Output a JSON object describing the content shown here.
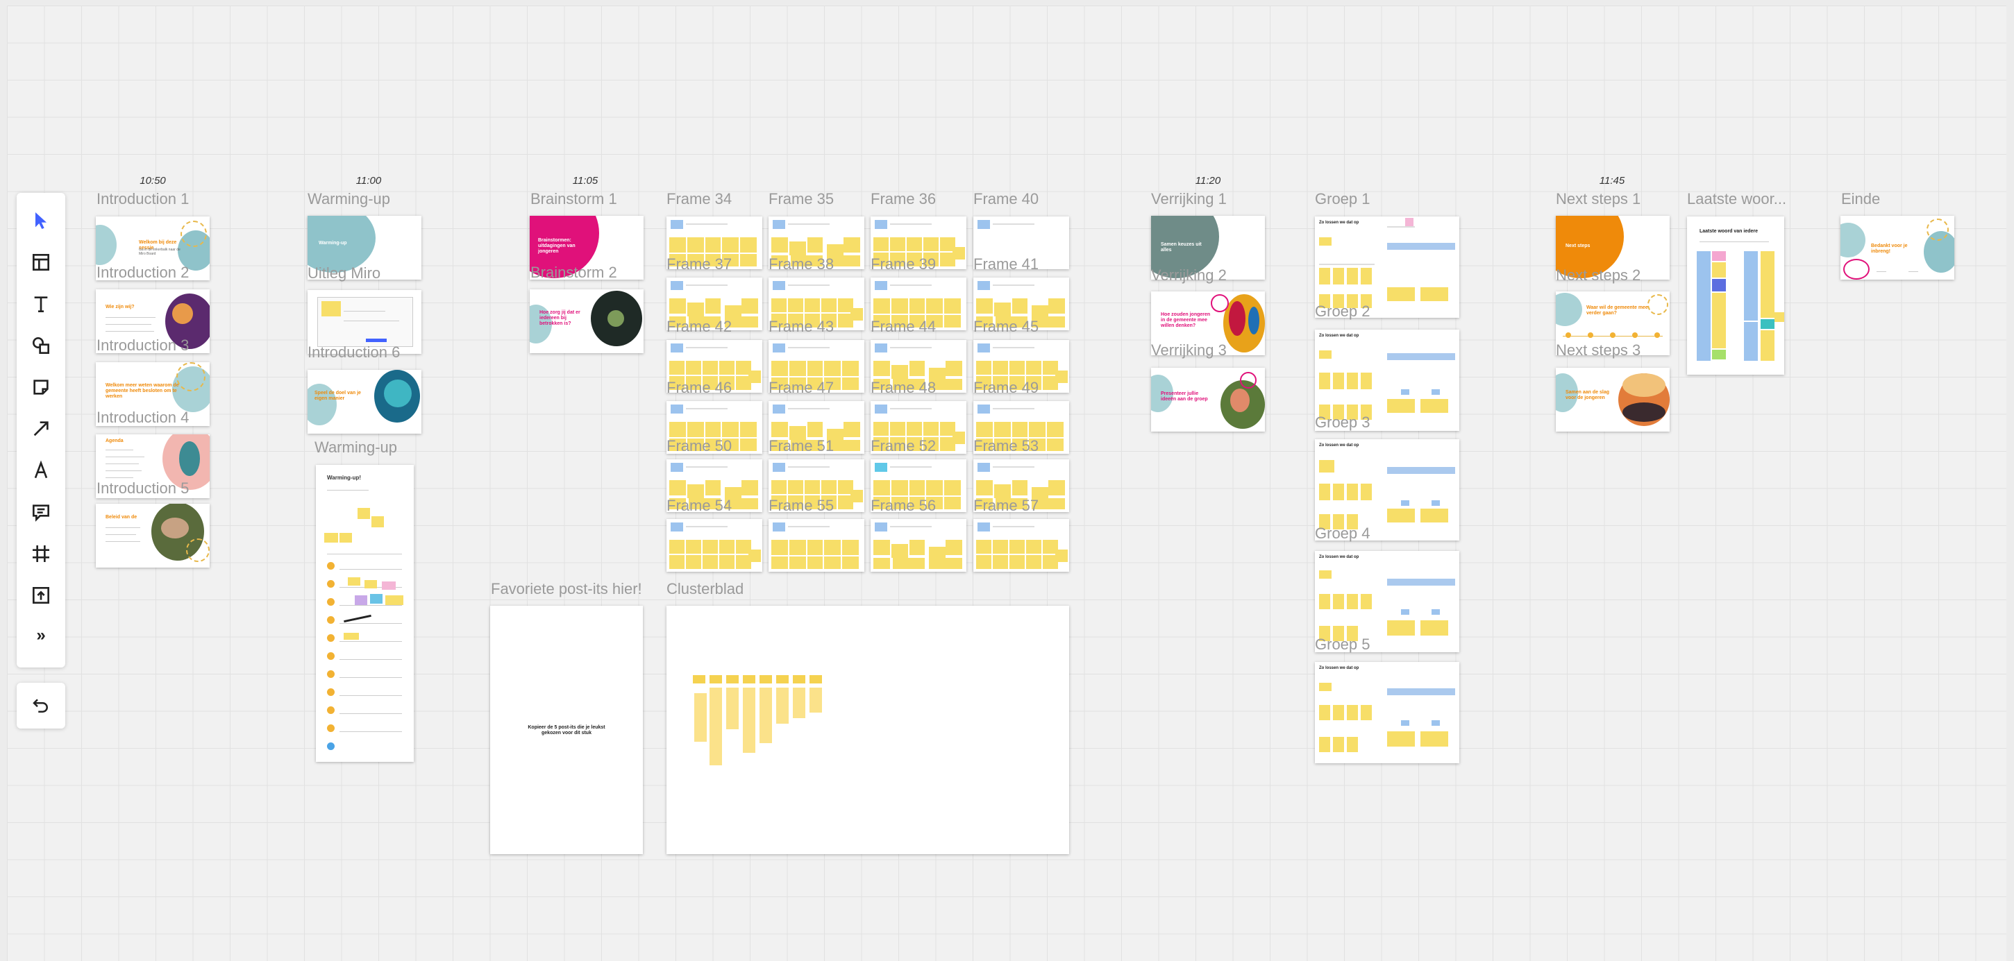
{
  "times": [
    "10:50",
    "11:00",
    "11:05",
    "11:20",
    "11:45"
  ],
  "frames": {
    "introduction_1": "Introduction 1",
    "introduction_2": "Introduction 2",
    "introduction_3": "Introduction 3",
    "introduction_4": "Introduction 4",
    "introduction_5": "Introduction 5",
    "warming_up_1": "Warming-up",
    "uitleg_miro": "Uitleg Miro",
    "introduction_6": "Introduction 6",
    "warming_up_2": "Warming-up",
    "brainstorm_1": "Brainstorm 1",
    "brainstorm_2": "Brainstorm 2",
    "favoriete": "Favoriete post-its hier!",
    "clusterblad": "Clusterblad",
    "verrijking_1": "Verrijking 1",
    "verrijking_2": "Verrijking 2",
    "verrijking_3": "Verrijking 3",
    "groep_1": "Groep 1",
    "groep_2": "Groep 2",
    "groep_3": "Groep 3",
    "groep_4": "Groep 4",
    "groep_5": "Groep 5",
    "next_steps_1": "Next steps 1",
    "next_steps_2": "Next steps 2",
    "next_steps_3": "Next steps 3",
    "laatste_woord": "Laatste woor...",
    "einde": "Einde"
  },
  "grid_frames": [
    "Frame 34",
    "Frame 35",
    "Frame 36",
    "Frame 40",
    "Frame 37",
    "Frame 38",
    "Frame 39",
    "Frame 41",
    "Frame 42",
    "Frame 43",
    "Frame 44",
    "Frame 45",
    "Frame 46",
    "Frame 47",
    "Frame 48",
    "Frame 49",
    "Frame 50",
    "Frame 51",
    "Frame 52",
    "Frame 53",
    "Frame 54",
    "Frame 55",
    "Frame 56",
    "Frame 57"
  ],
  "slides": {
    "intro1_title": "Welkom bij deze sessie",
    "intro1_sub": "Ga in de linkerbalk naar de Miro Board",
    "intro2_title": "Wie zijn wij?",
    "intro3_title": "Welkom meer weten waarom de gemeente heeft besloten om te werken",
    "intro4_title": "Agenda",
    "intro5_title": "Beleid van de",
    "warm_title": "Warming-up",
    "intro6_title": "Speel de doel van je eigen manier",
    "warm2_title": "Warming-up!",
    "brain1_title": "Brainstormen: uitdagingen van jongeren",
    "brain2_title": "Hoe zorg jij dat er iedereen bij betrokken is?",
    "fav_text": "Kopieer de 5 post-its die je leukst gekozen voor dit stuk",
    "verr1_title": "Samen keuzes uit alles",
    "verr2_title": "Hoe zouden jongeren in de gemeente mee willen denken?",
    "verr3_title": "Presenteer jullie ideeën aan de groep",
    "groep_title": "Zo lossen we dat op",
    "next1_title": "Next steps",
    "next2_title": "Waar wil de gemeente mee verder gaan?",
    "next3_title": "Samen aan de slag voor de jongeren",
    "laatste_title": "Laatste woord van iedere",
    "einde_title": "Bedankt voor je inbreng!"
  },
  "toolbar": {
    "tools": [
      "select-tool",
      "templates-tool",
      "text-tool",
      "shapes-tool",
      "sticky-note-tool",
      "arrow-tool",
      "pen-tool",
      "comment-tool",
      "frame-tool",
      "upload-tool",
      "more-tools"
    ],
    "more": "»"
  },
  "colors": {
    "accent": "#4262ff",
    "sticky_yellow": "#f7de68",
    "sticky_blue": "#9cc3ee",
    "teal": "#8fc3ca",
    "orange": "#ef8a0a",
    "magenta": "#e0117a",
    "gray_teal": "#6f8c88"
  }
}
